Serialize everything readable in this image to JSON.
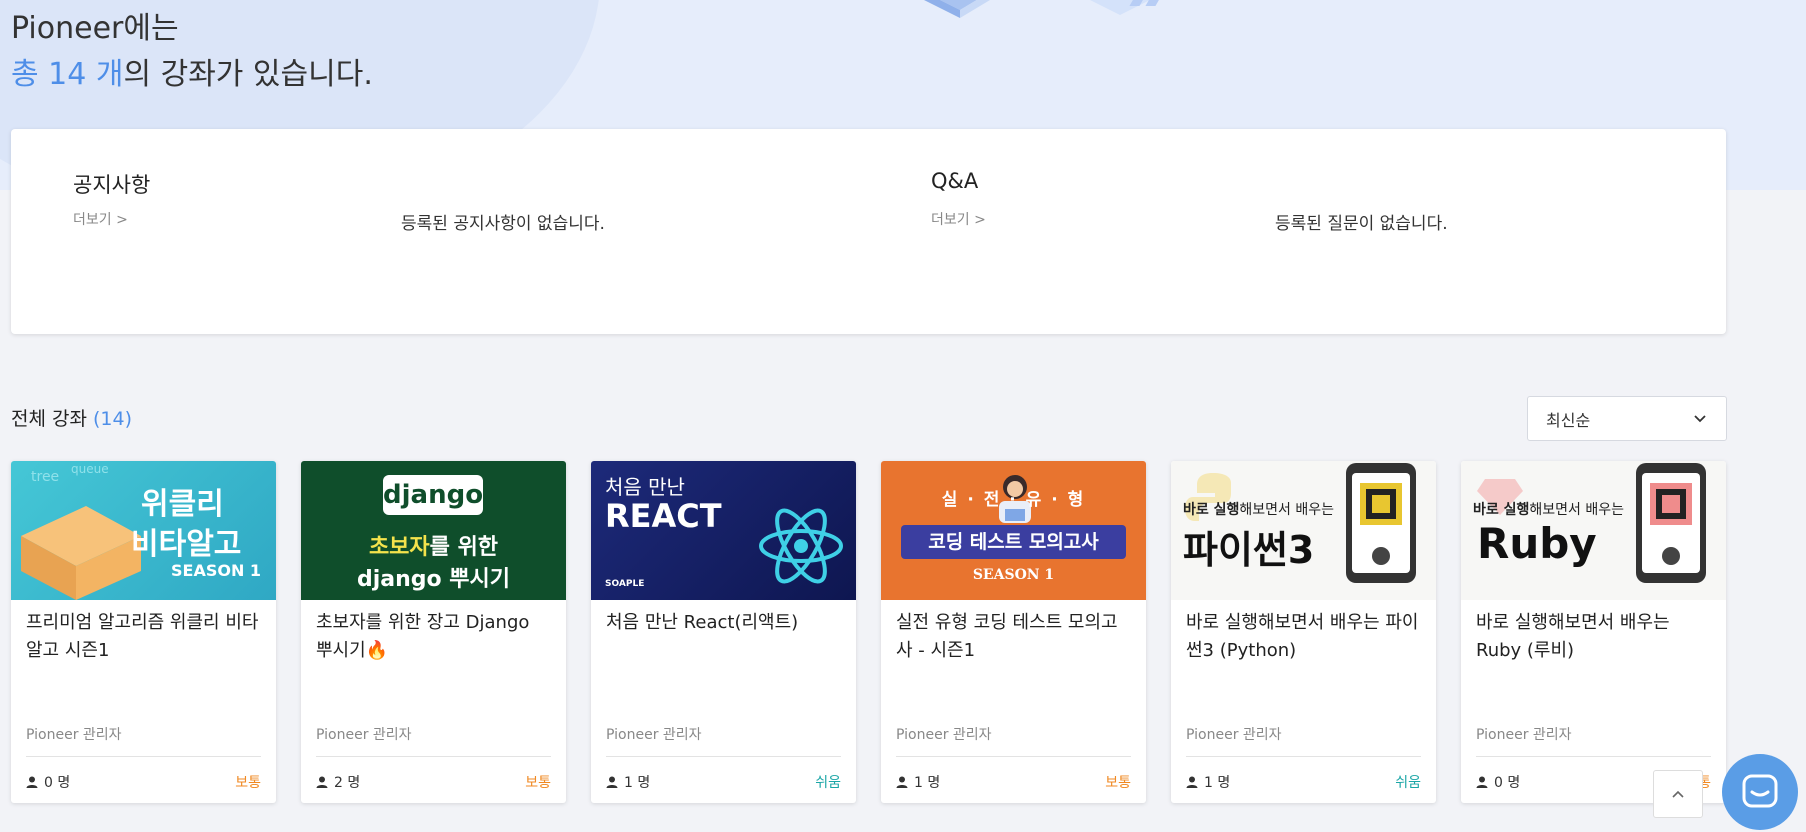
{
  "hero": {
    "line1": "Pioneer에는",
    "count_highlight": "총 14 개",
    "line2_rest": "의 강좌가 있습니다."
  },
  "boards": {
    "notice": {
      "title": "공지사항",
      "more": "더보기  >",
      "empty": "등록된 공지사항이 없습니다."
    },
    "qna": {
      "title": "Q&A",
      "more": "더보기  >",
      "empty": "등록된 질문이 없습니다."
    }
  },
  "courses_section": {
    "title": "전체 강좌",
    "count": "(14)",
    "sort_selected": "최신순",
    "sort_icon": "chevron-down-icon"
  },
  "courses": [
    {
      "title": "프리미엄 알고리즘 위클리 비타알고 시즌1",
      "author": "Pioneer 관리자",
      "students": "0 명",
      "level": "보통",
      "level_color": "#f08a24",
      "thumb": {
        "line1": "위클리",
        "line2": "비타알고",
        "line3": "SEASON 1"
      }
    },
    {
      "title": "초보자를 위한 장고 Django 뿌시기🔥",
      "author": "Pioneer 관리자",
      "students": "2 명",
      "level": "보통",
      "level_color": "#f08a24",
      "thumb": {
        "logo": "django",
        "line1": "초보자",
        "line1b": "를 위한",
        "line2": "django 뿌시기"
      }
    },
    {
      "title": "처음 만난 React(리액트)",
      "author": "Pioneer 관리자",
      "students": "1 명",
      "level": "쉬움",
      "level_color": "#1aa6a6",
      "thumb": {
        "line1": "처음 만난",
        "line2": "REACT",
        "brand": "SOAPLE"
      }
    },
    {
      "title": "실전 유형 코딩 테스트 모의고사 - 시즌1",
      "author": "Pioneer 관리자",
      "students": "1 명",
      "level": "보통",
      "level_color": "#f08a24",
      "thumb": {
        "line1": "실 · 전 · 유 · 형",
        "line2": "코딩 테스트 모의고사",
        "line3": "SEASON 1"
      }
    },
    {
      "title": "바로 실행해보면서 배우는 파이썬3 (Python)",
      "author": "Pioneer 관리자",
      "students": "1 명",
      "level": "쉬움",
      "level_color": "#1aa6a6",
      "thumb": {
        "line1a": "바로 실행",
        "line1b": "해보면서 배우는",
        "line2": "파이썬3"
      }
    },
    {
      "title": "바로 실행해보면서 배우는 Ruby (루비)",
      "author": "Pioneer 관리자",
      "students": "0 명",
      "level": "보통",
      "level_color": "#f08a24",
      "thumb": {
        "line1a": "바로 실행",
        "line1b": "해보면서 배우는",
        "line2": "Ruby"
      }
    }
  ],
  "colors": {
    "accent": "#4e8ee8",
    "hero_bg": "#e6edfb",
    "page_bg": "#f2f3f7",
    "chat_fab": "#5a9de6"
  },
  "floating": {
    "scroll_top_icon": "chevron-up-icon",
    "chat_icon": "chat-bubble-icon"
  }
}
